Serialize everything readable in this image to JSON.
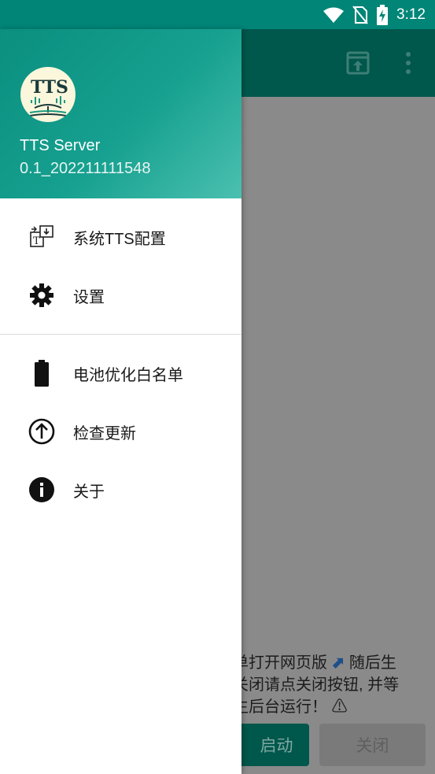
{
  "status_bar": {
    "time": "3:12"
  },
  "drawer": {
    "app_name": "TTS Server",
    "version": "0.1_202211111548",
    "logo_text": "TTS",
    "menu": [
      {
        "label": "系统TTS配置",
        "icon": "tts-config-icon"
      },
      {
        "label": "设置",
        "icon": "gear-icon"
      },
      {
        "label": "电池优化白名单",
        "icon": "battery-icon"
      },
      {
        "label": "检查更新",
        "icon": "arrow-up-circle-icon"
      },
      {
        "label": "关于",
        "icon": "info-icon"
      }
    ]
  },
  "background": {
    "hint_line1": "单打开网页版",
    "hint_line1b": "随后生",
    "hint_line2": "关闭请点关闭按钮, 并等",
    "hint_line3": "生后台运行！",
    "start_button": "启动",
    "close_button": "关闭"
  },
  "colors": {
    "primary": "#008577",
    "primary_dark": "#00574b",
    "accent": "#4bc0b0"
  }
}
